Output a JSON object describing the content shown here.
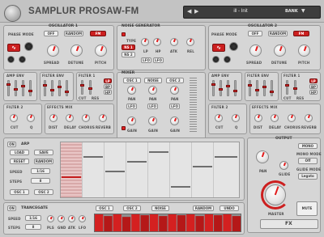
{
  "header": {
    "title": "SAMPLUR PROSAW-FM",
    "preset_name": "ill - Init",
    "bank_label": "BANK"
  },
  "osc1": {
    "title": "OSCILLATOR 1",
    "phase_mode_label": "PHASE MODE",
    "modes": [
      "OFF",
      "RANDOM",
      "FM"
    ],
    "active_mode": "FM",
    "knobs": [
      "SPREAD",
      "DETUNE",
      "PITCH"
    ]
  },
  "noise": {
    "title": "NOISE GENERATOR",
    "type_label": "TYPE",
    "types": [
      "NS 1",
      "NS 2"
    ],
    "knobs": [
      "LP",
      "HP",
      "ATK",
      "REL"
    ],
    "lfo_label": "LFO"
  },
  "osc2": {
    "title": "OSCILLATOR 2",
    "phase_mode_label": "PHASE MODE",
    "modes": [
      "OFF",
      "RANDOM",
      "FM"
    ],
    "active_mode": "FM",
    "knobs": [
      "SPREAD",
      "DETUNE",
      "PITCH"
    ]
  },
  "row2": {
    "amp_env": "AMP ENV",
    "filter_env": "FILTER ENV",
    "filter1": "FILTER 1",
    "mixer": "MIXER",
    "mixer_channels": [
      "OSC 1",
      "NOISE",
      "OSC 2"
    ],
    "pan_label": "PAN",
    "gain_label": "GAIN",
    "lfo_label": "LFO",
    "lp": "LP",
    "bp": "BP",
    "hp": "HP",
    "cut": "CUT",
    "res": "RES"
  },
  "row3": {
    "filter2": "FILTER 2",
    "effects_mix": "EFFECTS MIX",
    "cut": "CUT",
    "q": "Q",
    "fx": [
      "DIST",
      "DELAY",
      "CHORUS",
      "REVERB"
    ]
  },
  "arp": {
    "on_label": "ON",
    "title": "ARP",
    "buttons": [
      "LOAD",
      "SAVE",
      "RESET",
      "RANDOM"
    ],
    "speed_label": "SPEED",
    "speed_value": "1/16",
    "steps_label": "STEPS",
    "steps_value": "8",
    "osc_buttons": [
      "OSC 1",
      "OSC 2"
    ]
  },
  "trancegate": {
    "on_label": "ON",
    "title": "TRANCEGATE",
    "speed_label": "SPEED",
    "speed_value": "1/16",
    "steps_label": "STEPS",
    "steps_value": "8",
    "knobs": [
      "PLS",
      "GND",
      "ATK",
      "LFO"
    ],
    "targets": [
      "OSC 1",
      "OSC 2",
      "NOISE"
    ],
    "random_label": "RANDOM",
    "undo_label": "UNDO",
    "levels": [
      1.0,
      0.9,
      1.0,
      0.85,
      1.0,
      0.95,
      1.0,
      0.9,
      1.0,
      0.95,
      1.0,
      0.9,
      1.0,
      0.95,
      1.0,
      0.9
    ]
  },
  "output": {
    "title": "OUTPUT",
    "pan_label": "PAN",
    "glide_label": "GLIDE",
    "master_label": "MASTER",
    "mono_label": "MONO",
    "mono_mode_label": "MONO MODE",
    "mono_mode_value": "Off",
    "glide_mode_label": "GLIDE MODE",
    "glide_mode_value": "Legato",
    "mute_label": "MUTE",
    "fx_label": "FX"
  },
  "colors": {
    "accent": "#cc1f1f",
    "panel": "#d6d6d6",
    "bg": "#c9c9c9"
  }
}
